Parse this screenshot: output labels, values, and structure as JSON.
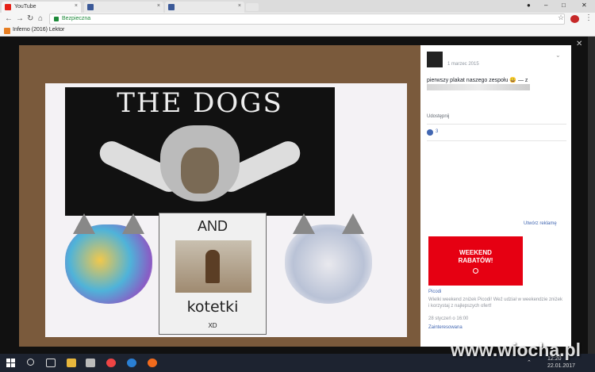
{
  "browser": {
    "tabs": [
      {
        "label": "YouTube",
        "favicon_color": "#e62117"
      },
      {
        "label": "",
        "favicon_color": "#3b5998"
      },
      {
        "label": "",
        "favicon_color": "#3b5998"
      }
    ],
    "security_label": "Bezpieczna",
    "bookmark_label": "Inferno (2016) Lektor"
  },
  "photo": {
    "title": "THE DOGS",
    "and_label": "AND",
    "kotetki_label": "kotetki",
    "xd_label": "XD"
  },
  "post": {
    "date": "1 marzec 2015",
    "text": "pierwszy plakat naszego zespołu 😀 — z",
    "share_label": "Udostępnij",
    "like_count": "3"
  },
  "sidebar": {
    "create_ad_label": "Utwórz reklamę",
    "ad_banner_text": "WEEKEND\nRABATÓW!",
    "ad_brand": "Picodi",
    "ad_text": "Wielki weekend zniżek Picodi! Weź udział w weekendzie zniżek i korzystaj z najlepszych ofert!",
    "ad_date": "28 styczeń o 16:00",
    "ad_interest": "Zainteresowana"
  },
  "taskbar": {
    "time": "12:20",
    "date": "22.01.2017"
  },
  "watermark": "www.wiocha.pl",
  "colors": {
    "facebook_blue": "#4267b2",
    "ad_red": "#e60012",
    "secure_green": "#1e8a3a"
  }
}
